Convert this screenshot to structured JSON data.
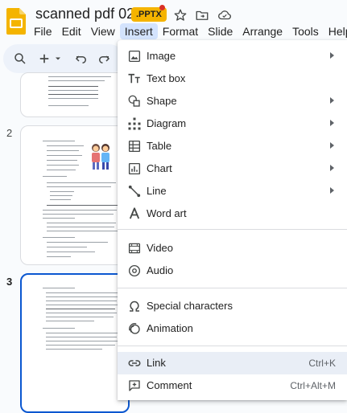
{
  "header": {
    "title": "scanned pdf 02",
    "badge": ".PPTX"
  },
  "menubar": {
    "items": [
      "File",
      "Edit",
      "View",
      "Insert",
      "Format",
      "Slide",
      "Arrange",
      "Tools",
      "Help"
    ],
    "active": "Insert"
  },
  "slides": {
    "numbers": [
      "2",
      "3"
    ],
    "active": "3"
  },
  "insert_menu": {
    "items": [
      {
        "label": "Image",
        "icon": "image-icon",
        "submenu": true
      },
      {
        "label": "Text box",
        "icon": "text-box-icon",
        "submenu": false
      },
      {
        "label": "Shape",
        "icon": "shape-icon",
        "submenu": true
      },
      {
        "label": "Diagram",
        "icon": "diagram-icon",
        "submenu": true
      },
      {
        "label": "Table",
        "icon": "table-icon",
        "submenu": true
      },
      {
        "label": "Chart",
        "icon": "chart-icon",
        "submenu": true
      },
      {
        "label": "Line",
        "icon": "line-icon",
        "submenu": true
      },
      {
        "label": "Word art",
        "icon": "word-art-icon",
        "submenu": false
      },
      {
        "label": "Video",
        "icon": "video-icon",
        "submenu": false
      },
      {
        "label": "Audio",
        "icon": "audio-icon",
        "submenu": false
      },
      {
        "label": "Special characters",
        "icon": "omega-icon",
        "submenu": false
      },
      {
        "label": "Animation",
        "icon": "animation-icon",
        "submenu": false
      },
      {
        "label": "Link",
        "icon": "link-icon",
        "shortcut": "Ctrl+K",
        "highlighted": true
      },
      {
        "label": "Comment",
        "icon": "comment-add-icon",
        "shortcut": "Ctrl+Alt+M"
      }
    ]
  },
  "colors": {
    "accent": "#0b57d0",
    "badge": "#f5b400",
    "menu_hover": "#e9eef6",
    "active_menu": "#d3e3fd"
  }
}
